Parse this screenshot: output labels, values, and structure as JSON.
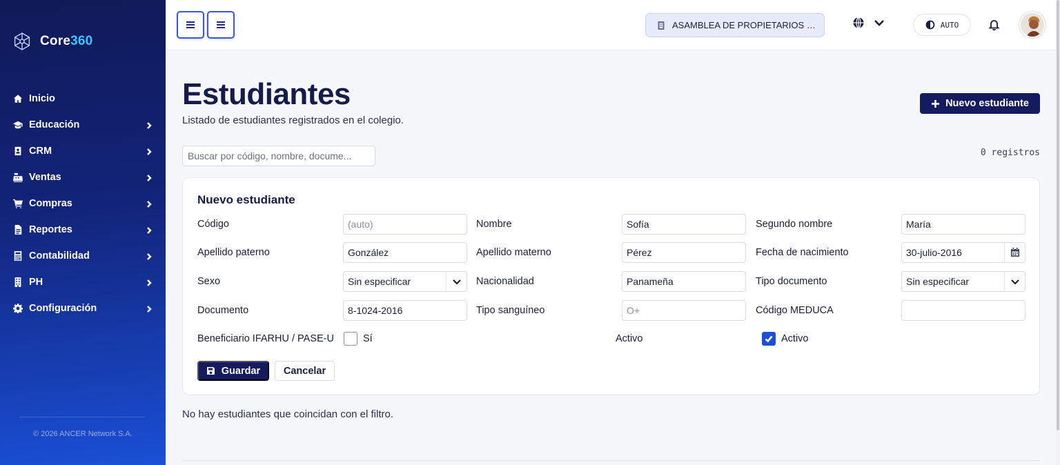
{
  "brand": {
    "name_a": "Core",
    "name_b": "360"
  },
  "sidebar": {
    "items": [
      {
        "label": "Inicio",
        "icon": "home-icon",
        "expandable": false
      },
      {
        "label": "Educación",
        "icon": "graduation-cap-icon",
        "expandable": true
      },
      {
        "label": "CRM",
        "icon": "contact-card-icon",
        "expandable": true
      },
      {
        "label": "Ventas",
        "icon": "cash-register-icon",
        "expandable": true
      },
      {
        "label": "Compras",
        "icon": "cart-icon",
        "expandable": true
      },
      {
        "label": "Reportes",
        "icon": "report-file-icon",
        "expandable": true
      },
      {
        "label": "Contabilidad",
        "icon": "calculator-icon",
        "expandable": true
      },
      {
        "label": "PH",
        "icon": "building-icon",
        "expandable": true
      },
      {
        "label": "Configuración",
        "icon": "gear-icon",
        "expandable": true
      }
    ],
    "copyright": "© 2026 ANCER Network S.A."
  },
  "topbar": {
    "organization": "ASAMBLEA DE PROPIETARIOS DE ...",
    "theme_label": "AUTO"
  },
  "page": {
    "title": "Estudiantes",
    "subtitle": "Listado de estudiantes registrados en el colegio.",
    "new_button": "Nuevo estudiante",
    "search_placeholder": "Buscar por código, nombre, docume...",
    "records": "0 registros",
    "empty_message": "No hay estudiantes que coincidan con el filtro."
  },
  "form": {
    "title": "Nuevo estudiante",
    "fields": {
      "codigo": {
        "label": "Código",
        "value": "",
        "placeholder": "(auto)"
      },
      "nombre": {
        "label": "Nombre",
        "value": "Sofía"
      },
      "segundo_nombre": {
        "label": "Segundo nombre",
        "value": "María"
      },
      "apellido_paterno": {
        "label": "Apellido paterno",
        "value": "González"
      },
      "apellido_materno": {
        "label": "Apellido materno",
        "value": "Pérez"
      },
      "fecha_nacimiento": {
        "label": "Fecha de nacimiento",
        "value": "30-julio-2016"
      },
      "sexo": {
        "label": "Sexo",
        "value": "Sin especificar"
      },
      "nacionalidad": {
        "label": "Nacionalidad",
        "value": "Panameña"
      },
      "tipo_documento": {
        "label": "Tipo documento",
        "value": "Sin especificar"
      },
      "documento": {
        "label": "Documento",
        "value": "8-1024-2016"
      },
      "tipo_sanguineo": {
        "label": "Tipo sanguíneo",
        "value": "",
        "placeholder": "O+"
      },
      "codigo_meduca": {
        "label": "Código MEDUCA",
        "value": ""
      },
      "beneficiario": {
        "label": "Beneficiario IFARHU / PASE-U",
        "option": "Sí",
        "checked": false
      },
      "activo": {
        "label": "Activo",
        "option": "Activo",
        "checked": true
      }
    },
    "save_label": "Guardar",
    "cancel_label": "Cancelar"
  }
}
